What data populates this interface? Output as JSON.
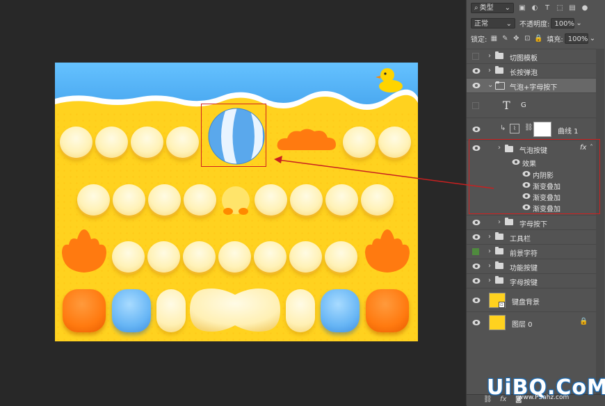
{
  "layers_panel": {
    "filter_kind": "类型",
    "blend_mode": "正常",
    "opacity_label": "不透明度:",
    "opacity_value": "100%",
    "lock_label": "锁定:",
    "fill_label": "填充:",
    "fill_value": "100%",
    "layers": [
      {
        "name": "切图模板",
        "kind": "group",
        "visible": false
      },
      {
        "name": "长按弹泡",
        "kind": "group",
        "visible": true
      },
      {
        "name": "气泡+字母按下",
        "kind": "group-open",
        "visible": true
      },
      {
        "name": "G",
        "kind": "text",
        "visible": false
      },
      {
        "name": "曲线 1",
        "kind": "adjustment",
        "visible": true
      },
      {
        "name": "气泡按键",
        "kind": "group",
        "visible": true,
        "fx": "fx"
      },
      {
        "name": "效果",
        "kind": "effect-header",
        "visible": true
      },
      {
        "name": "内阴影",
        "kind": "effect",
        "visible": true
      },
      {
        "name": "渐变叠加",
        "kind": "effect",
        "visible": true
      },
      {
        "name": "渐变叠加",
        "kind": "effect",
        "visible": true
      },
      {
        "name": "渐变叠加",
        "kind": "effect",
        "visible": true
      },
      {
        "name": "字母按下",
        "kind": "group",
        "visible": true
      },
      {
        "name": "工具栏",
        "kind": "group",
        "visible": true
      },
      {
        "name": "前景字符",
        "kind": "group",
        "visible": false
      },
      {
        "name": "功能按键",
        "kind": "group",
        "visible": true
      },
      {
        "name": "字母按键",
        "kind": "group",
        "visible": true
      },
      {
        "name": "键盘背景",
        "kind": "smart",
        "visible": true
      },
      {
        "name": "图层 0",
        "kind": "pixel",
        "visible": true
      }
    ]
  },
  "watermark": {
    "main": "UiBQ.CoM",
    "sub": "www.PSahz.com"
  },
  "colors": {
    "panel": "#535353",
    "sand": "#ffd21f",
    "sky": "#4aa8f0",
    "highlight": "#d0201f"
  }
}
